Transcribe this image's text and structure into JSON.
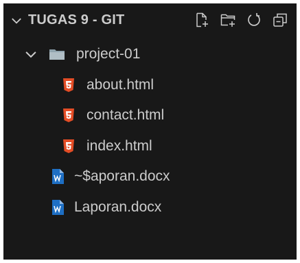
{
  "explorer": {
    "title": "TUGAS 9 - GIT",
    "actions": [
      {
        "name": "new-file-icon"
      },
      {
        "name": "new-folder-icon"
      },
      {
        "name": "refresh-icon"
      },
      {
        "name": "collapse-all-icon"
      }
    ]
  },
  "tree": {
    "folder": {
      "label": "project-01",
      "icon": "folder-icon",
      "expanded": true
    },
    "folder_children": [
      {
        "label": "about.html",
        "icon": "html5-icon"
      },
      {
        "label": "contact.html",
        "icon": "html5-icon"
      },
      {
        "label": "index.html",
        "icon": "html5-icon"
      }
    ],
    "root_files": [
      {
        "label": "~$aporan.docx",
        "icon": "word-doc-icon"
      },
      {
        "label": "Laporan.docx",
        "icon": "word-doc-icon"
      }
    ]
  },
  "colors": {
    "background": "#181818",
    "text": "#cccccc",
    "html_icon": "#e44d26",
    "word_icon": "#1e6fc4"
  }
}
